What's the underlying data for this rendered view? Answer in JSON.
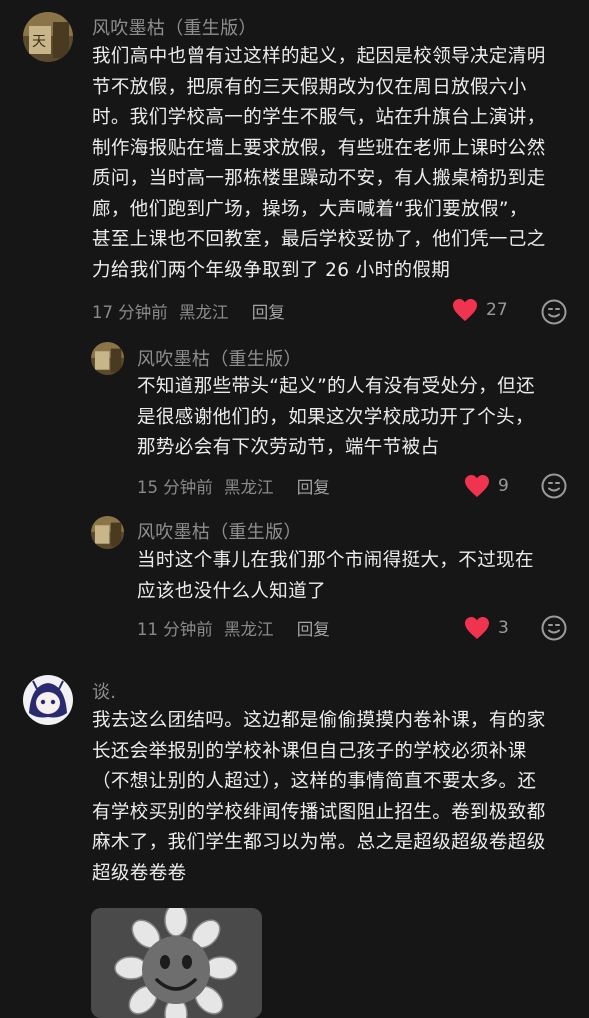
{
  "comments": [
    {
      "username": "风吹墨枯（重生版）",
      "lines": [
        "我们高中也曾有过这样的起义，起因是校领导决定清明",
        "节不放假，把原有的三天假期改为仅在周日放假六小",
        "时。我们学校高一的学生不服气，站在升旗台上演讲，",
        "制作海报贴在墙上要求放假，有些班在老师上课时公然",
        "质问，当时高一那栋楼里躁动不安，有人搬桌椅扔到走",
        "廊，他们跑到广场，操场，大声喊着“我们要放假”，",
        "甚至上课也不回教室，最后学校妥协了，他们凭一己之",
        "力给我们两个年级争取到了 26 小时的假期"
      ],
      "time": "17 分钟前",
      "location": "黑龙江",
      "reply": "回复",
      "likes": "27"
    },
    {
      "username": "风吹墨枯（重生版）",
      "lines": [
        "不知道那些带头“起义”的人有没有受处分，但还",
        "是很感谢他们的，如果这次学校成功开了个头，",
        "那势必会有下次劳动节，端午节被占"
      ],
      "time": "15 分钟前",
      "location": "黑龙江",
      "reply": "回复",
      "likes": "9"
    },
    {
      "username": "风吹墨枯（重生版）",
      "lines": [
        "当时这个事儿在我们那个市闹得挺大，不过现在",
        "应该也没什么人知道了"
      ],
      "time": "11 分钟前",
      "location": "黑龙江",
      "reply": "回复",
      "likes": "3"
    },
    {
      "username": "谈.",
      "lines": [
        "我去这么团结吗。这边都是偷偷摸摸内卷补课，有的家",
        "长还会举报别的学校补课但自己孩子的学校必须补课",
        "（不想让别的人超过），这样的事情简直不要太多。还",
        "有学校买别的学校绯闻传播试图阻止招生。卷到极致都",
        "麻木了，我们学生都习以为常。总之是超级超级卷超级",
        "超级卷卷卷"
      ]
    }
  ],
  "colors": {
    "background": "#161616",
    "heart": "#f0334e",
    "meta_text": "#8a8a8a"
  },
  "icons": [
    "heart-icon",
    "emoji-reaction-icon"
  ]
}
